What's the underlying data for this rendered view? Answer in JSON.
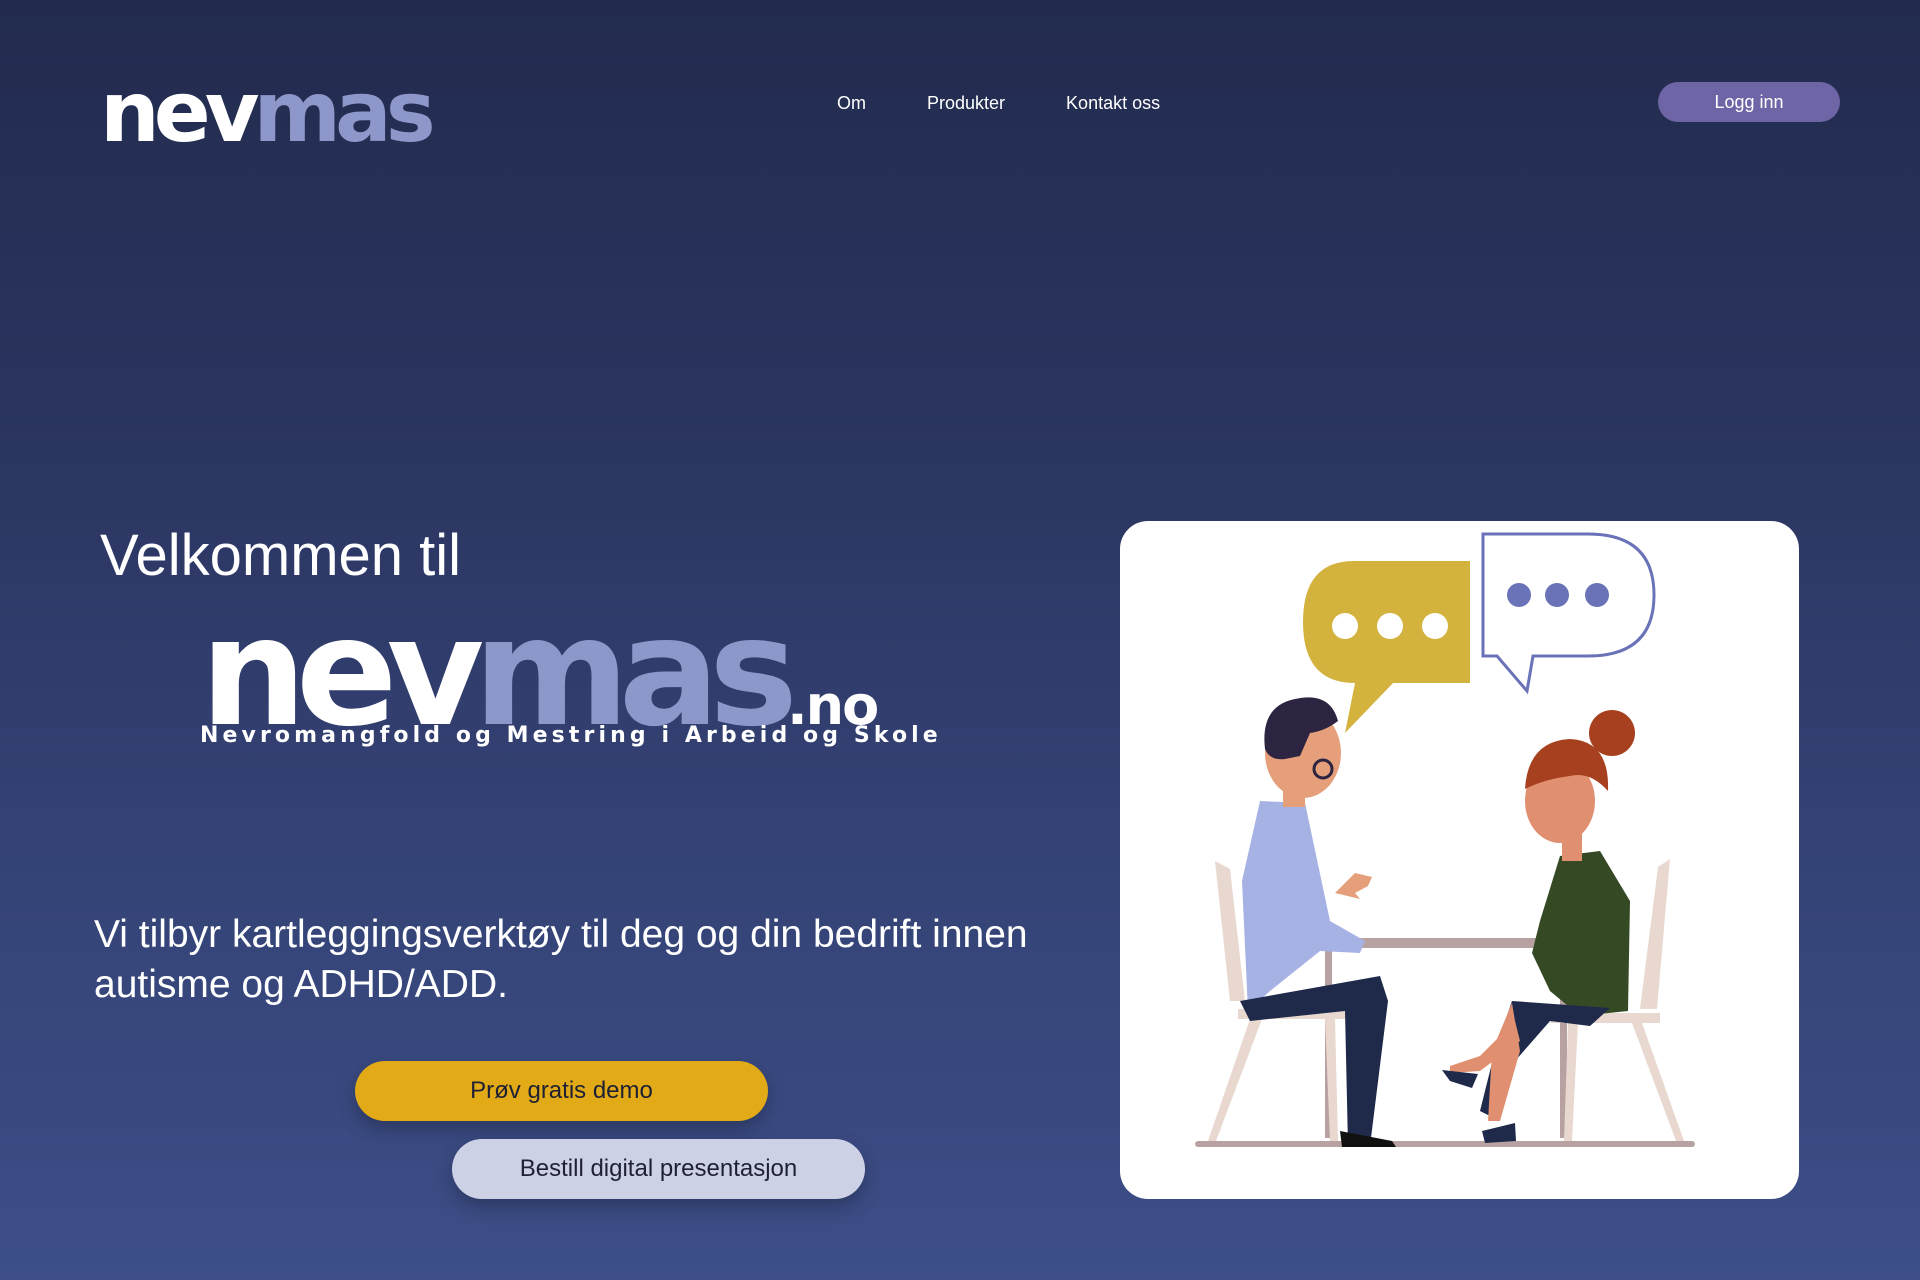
{
  "header": {
    "logo": {
      "part1": "nev",
      "part2": "mas"
    },
    "nav": [
      "Om",
      "Produkter",
      "Kontakt oss"
    ],
    "login_label": "Logg inn"
  },
  "hero": {
    "welcome": "Velkommen til",
    "logo": {
      "part1": "nev",
      "part2": "mas",
      "tld": ".no",
      "tagline": "Nevromangfold og  Mestring i Arbeid og Skole"
    },
    "intro": "Vi tilbyr kartleggingsverktøy til deg og din bedrift innen autisme og ADHD/ADD.",
    "demo_button": "Prøv gratis demo",
    "presentation_button": "Bestill digital presentasjon"
  },
  "colors": {
    "background_top": "#222b4d",
    "background_bottom": "#3d4e88",
    "logo_accent": "#8e97c9",
    "login_button": "#6e65a6",
    "demo_button": "#e1aa16",
    "presentation_button": "#cdd1e6"
  },
  "illustration": {
    "icons": [
      "speech-bubble-icon",
      "speech-bubble-outline-icon"
    ]
  }
}
